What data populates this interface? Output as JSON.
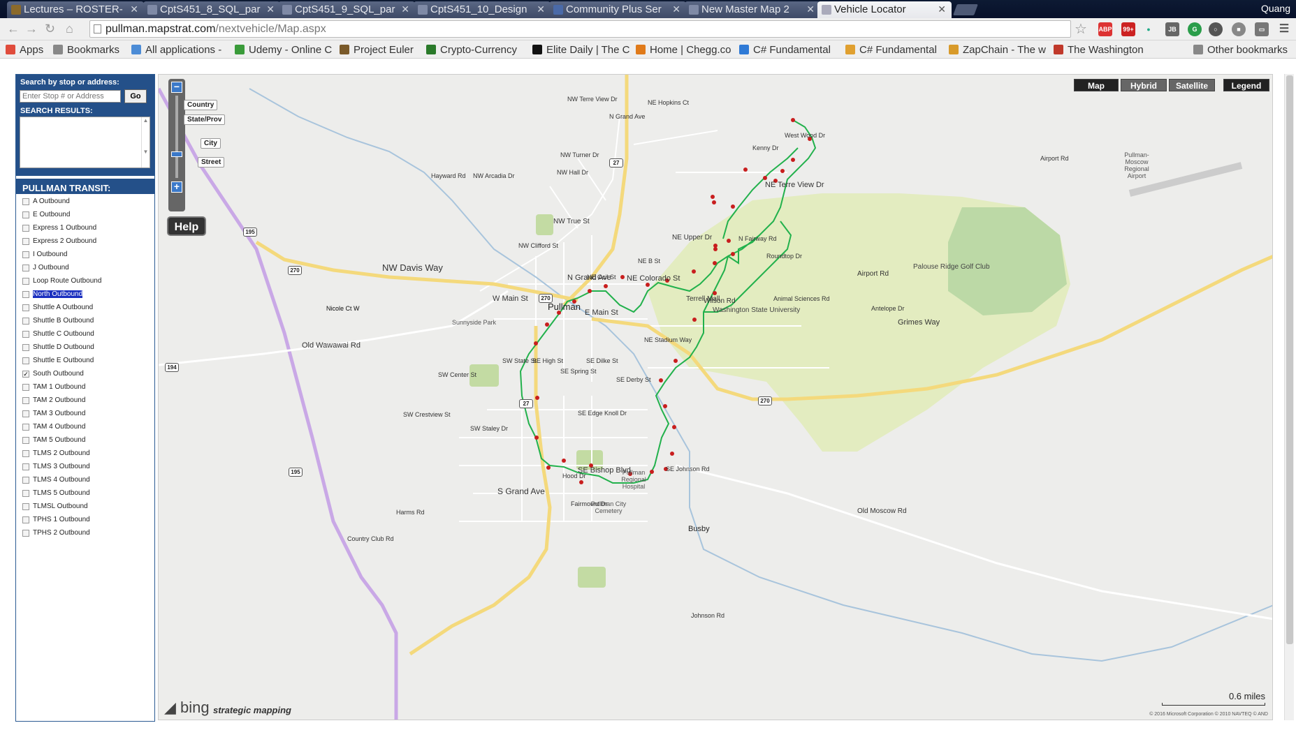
{
  "browser": {
    "tabs": [
      {
        "label": "Lectures – ROSTER-",
        "icon": "bb-icon",
        "color": "#8b6a2b"
      },
      {
        "label": "CptS451_8_SQL_par",
        "icon": "doc-icon",
        "color": "#7f8aa6"
      },
      {
        "label": "CptS451_9_SQL_par",
        "icon": "doc-icon",
        "color": "#7f8aa6"
      },
      {
        "label": "CptS451_10_Design",
        "icon": "doc-icon",
        "color": "#7f8aa6"
      },
      {
        "label": "Community Plus Ser",
        "icon": "community-icon",
        "color": "#4a6aa8"
      },
      {
        "label": "New Master Map 2",
        "icon": "map-icon",
        "color": "#7f8aa6"
      },
      {
        "label": "Vehicle Locator",
        "icon": "page-icon",
        "color": "#aab"
      }
    ],
    "user": "Quang",
    "url_host": "pullman.mapstrat.com",
    "url_path": "/nextvehicle/Map.aspx",
    "bookmarks": [
      {
        "label": "Apps",
        "icon": "apps-icon",
        "color": "#e04c3c"
      },
      {
        "label": "Bookmarks",
        "icon": "star-icon",
        "color": "#888"
      },
      {
        "label": "All applications -",
        "icon": "play-icon",
        "color": "#4c8cd6"
      },
      {
        "label": "Udemy - Online C",
        "icon": "udemy-icon",
        "color": "#3a9b3a"
      },
      {
        "label": "Project Euler",
        "icon": "euler-icon",
        "color": "#7a5a2a"
      },
      {
        "label": "Crypto-Currency",
        "icon": "dollar-icon",
        "color": "#2a7a2a"
      },
      {
        "label": "Elite Daily | The C",
        "icon": "ed-icon",
        "color": "#111"
      },
      {
        "label": "Home | Chegg.co",
        "icon": "chegg-icon",
        "color": "#e07a1a"
      },
      {
        "label": "C# Fundamental",
        "icon": "ms-icon",
        "color": "#2f7ad6"
      },
      {
        "label": "C# Fundamental",
        "icon": "dev-icon",
        "color": "#e0a030"
      },
      {
        "label": "ZapChain - The w",
        "icon": "zap-icon",
        "color": "#d89a2a"
      },
      {
        "label": "The Washington",
        "icon": "wp-icon",
        "color": "#c0392b"
      },
      {
        "label": "Other bookmarks",
        "icon": "folder-icon",
        "color": "#888"
      }
    ]
  },
  "panel": {
    "search_label": "Search by stop or address:",
    "search_placeholder": "Enter Stop # or Address",
    "go_label": "Go",
    "results_label": "SEARCH RESULTS:",
    "transit_header": "PULLMAN TRANSIT:",
    "routes": [
      {
        "label": "A Outbound",
        "checked": false,
        "selected": false
      },
      {
        "label": "E Outbound",
        "checked": false,
        "selected": false
      },
      {
        "label": "Express 1 Outbound",
        "checked": false,
        "selected": false
      },
      {
        "label": "Express 2 Outbound",
        "checked": false,
        "selected": false
      },
      {
        "label": "I Outbound",
        "checked": false,
        "selected": false
      },
      {
        "label": "J Outbound",
        "checked": false,
        "selected": false
      },
      {
        "label": "Loop Route Outbound",
        "checked": false,
        "selected": false
      },
      {
        "label": "North Outbound",
        "checked": false,
        "selected": true
      },
      {
        "label": "Shuttle A Outbound",
        "checked": false,
        "selected": false
      },
      {
        "label": "Shuttle B Outbound",
        "checked": false,
        "selected": false
      },
      {
        "label": "Shuttle C Outbound",
        "checked": false,
        "selected": false
      },
      {
        "label": "Shuttle D Outbound",
        "checked": false,
        "selected": false
      },
      {
        "label": "Shuttle E Outbound",
        "checked": false,
        "selected": false
      },
      {
        "label": "South Outbound",
        "checked": true,
        "selected": false
      },
      {
        "label": "TAM 1 Outbound",
        "checked": false,
        "selected": false
      },
      {
        "label": "TAM 2 Outbound",
        "checked": false,
        "selected": false
      },
      {
        "label": "TAM 3 Outbound",
        "checked": false,
        "selected": false
      },
      {
        "label": "TAM 4 Outbound",
        "checked": false,
        "selected": false
      },
      {
        "label": "TAM 5 Outbound",
        "checked": false,
        "selected": false
      },
      {
        "label": "TLMS 2 Outbound",
        "checked": false,
        "selected": false
      },
      {
        "label": "TLMS 3 Outbound",
        "checked": false,
        "selected": false
      },
      {
        "label": "TLMS 4 Outbound",
        "checked": false,
        "selected": false
      },
      {
        "label": "TLMS 5 Outbound",
        "checked": false,
        "selected": false
      },
      {
        "label": "TLMSL Outbound",
        "checked": false,
        "selected": false
      },
      {
        "label": "TPHS 1 Outbound",
        "checked": false,
        "selected": false
      },
      {
        "label": "TPHS 2 Outbound",
        "checked": false,
        "selected": false
      }
    ]
  },
  "map": {
    "zoom_levels": [
      "Country",
      "State/Prov",
      "City",
      "Street"
    ],
    "zoom_in": "+",
    "zoom_out": "−",
    "help_label": "Help",
    "map_types": [
      "Map",
      "Hybrid",
      "Satellite"
    ],
    "active_map_type": "Map",
    "legend_label": "Legend",
    "scale_label": "0.6 miles",
    "copyright": "© 2016 Microsoft Corporation   © 2010 NAVTEQ   © AND",
    "bing_label": "bing",
    "brand_label": "strategic mapping",
    "route_color": "#22b14c",
    "stop_color": "#c81e1e",
    "park_color": "#e3ecc0",
    "highway_color": "#f4d97c",
    "us195_color": "#c9a8e6",
    "highways": {
      "us195": "195",
      "wa270": "270",
      "wa27": "27",
      "wa194": "194"
    },
    "labels": {
      "places": [
        "Pullman",
        "Busby",
        "Sunnyside Park",
        "Palouse Ridge Golf Club",
        "Washington State University",
        "Pullman Regional Hospital",
        "Pullman City Cemetery",
        "Pullman-Moscow Regional Airport",
        "Terrell Mall"
      ],
      "roads": [
        "NW Davis Way",
        "E Main St",
        "W Main St",
        "Old Wawawai Rd",
        "S Grand Ave",
        "N Grand Ave",
        "NE Terre View Dr",
        "NE Colorado St",
        "SE Bishop Blvd",
        "Old Moscow Rd",
        "Grimes Way",
        "Wilson Rd",
        "NE Stadium Way",
        "Airport Rd",
        "Hayward Rd",
        "Harms Rd",
        "Country Club Rd",
        "NW Terre View Dr",
        "NE Hopkins Ct",
        "NW True St",
        "NE Upper Dr",
        "N Fairway Rd",
        "Roundtop Dr",
        "Animal Sciences Rd",
        "Antelope Dr",
        "SW State St",
        "SE High St",
        "SE Spring St",
        "SE Dilke St",
        "SE Derby St",
        "SE Edge Knoll Dr",
        "SW Center St",
        "SW Crestview St",
        "SW Staley Dr",
        "Nicole Ct W",
        "NW Clifford St",
        "NW Arcadia Dr",
        "NW Turner Dr",
        "NW Hall Dr",
        "SE Johnson Rd",
        "Johnson Rd",
        "Hood Dr",
        "Fairmount Dr",
        "NE B St",
        "NE Ocil St",
        "West Wood Dr",
        "Kenny Dr",
        "Airport Rd",
        "N Grand Ave",
        "Nicole Ct W"
      ]
    }
  }
}
